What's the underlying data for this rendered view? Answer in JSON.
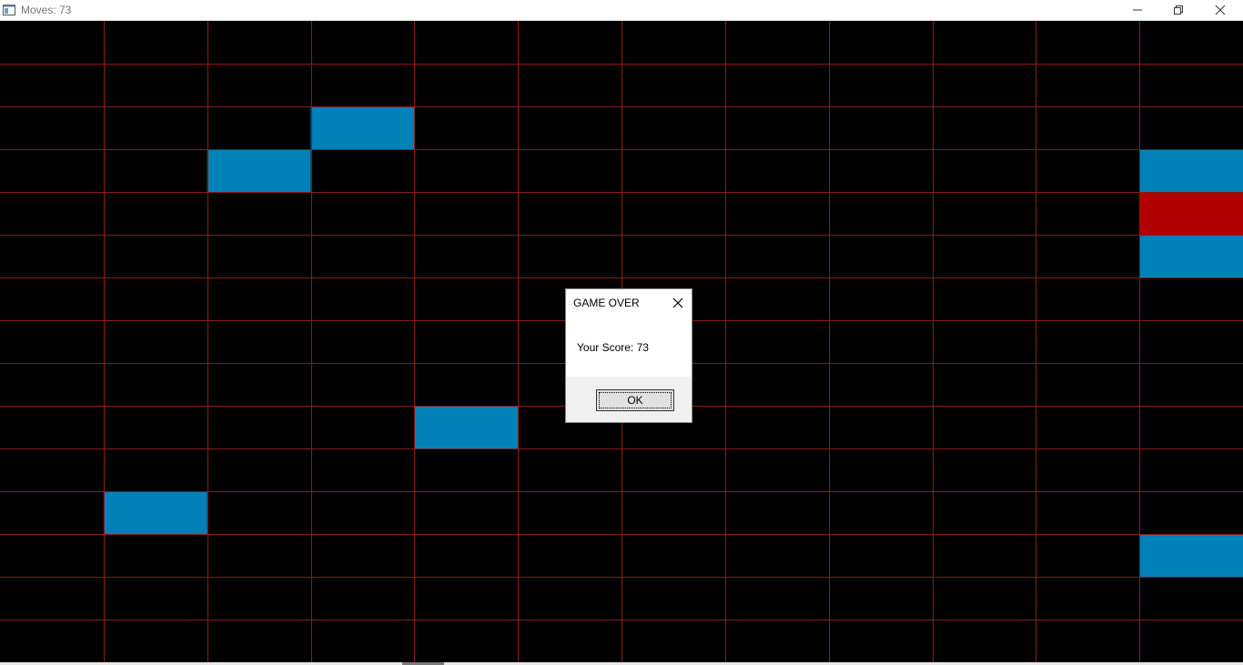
{
  "window": {
    "title": "Moves: 73"
  },
  "board": {
    "columns": 12,
    "rows": 15,
    "background_color": "#000000",
    "grid_line_color": "#8b1a1a",
    "cells": [
      {
        "col": 3,
        "row": 2,
        "color": "#0082b8",
        "kind": "block"
      },
      {
        "col": 2,
        "row": 3,
        "color": "#0082b8",
        "kind": "block"
      },
      {
        "col": 11,
        "row": 3,
        "color": "#0082b8",
        "kind": "block"
      },
      {
        "col": 11,
        "row": 4,
        "color": "#b00000",
        "kind": "player"
      },
      {
        "col": 11,
        "row": 5,
        "color": "#0082b8",
        "kind": "block"
      },
      {
        "col": 4,
        "row": 9,
        "color": "#0082b8",
        "kind": "block"
      },
      {
        "col": 1,
        "row": 11,
        "color": "#0082b8",
        "kind": "block"
      },
      {
        "col": 11,
        "row": 12,
        "color": "#0082b8",
        "kind": "block"
      }
    ]
  },
  "dialog": {
    "title": "GAME OVER",
    "message": "Your Score: 73",
    "ok_label": "OK"
  },
  "icons": {
    "app": "app-window-icon",
    "minimize": "minimize-icon",
    "restore": "restore-icon",
    "close": "close-icon"
  }
}
